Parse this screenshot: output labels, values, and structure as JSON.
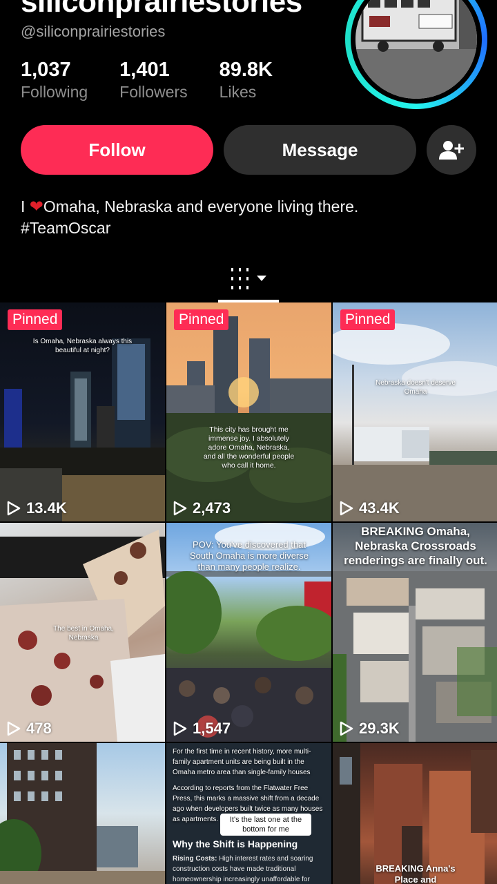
{
  "profile": {
    "display_name": "siliconprairiestories",
    "handle": "@siliconprairiestories",
    "stats": [
      {
        "value": "1,037",
        "label": "Following"
      },
      {
        "value": "1,401",
        "label": "Followers"
      },
      {
        "value": "89.8K",
        "label": "Likes"
      }
    ],
    "bio_line1": "Omaha, Nebraska and everyone living there.",
    "bio_prefix": "I",
    "bio_line2": "#TeamOscar"
  },
  "actions": {
    "follow_label": "Follow",
    "message_label": "Message",
    "add_friend_icon": "add-person-icon"
  },
  "tabs": {
    "active_icon": "grid-filter-icon"
  },
  "videos": [
    {
      "pinned": "Pinned",
      "views": "13.4K",
      "caption": "Is Omaha, Nebraska always this beautiful at night?"
    },
    {
      "pinned": "Pinned",
      "views": "2,473",
      "caption": "This city has brought me immense joy. I absolutely adore Omaha, Nebraska, and all the wonderful people who call it home."
    },
    {
      "pinned": "Pinned",
      "views": "43.4K",
      "caption": "Nebraska doesn't deserve Omaha"
    },
    {
      "views": "478",
      "caption": "The best in Omaha, Nebraska"
    },
    {
      "views": "1,547",
      "caption": "POV: You've discovered that South Omaha is more diverse than many people realize."
    },
    {
      "views": "29.3K",
      "caption": "BREAKING Omaha, Nebraska Crossroads renderings are finally out."
    },
    {
      "views": "",
      "caption": ""
    },
    {
      "views": "",
      "caption_top": "For the first time in recent history, more multi-family apartment units are being built in the Omaha metro area than single-family houses",
      "caption_mid": "According to reports from the Flatwater Free Press, this marks a massive shift from a decade ago when developers built twice as many houses as apartments.",
      "bubble": "It's the last one at the bottom for me",
      "heading": "Why the Shift is Happening",
      "bullet_title": "Rising Costs:",
      "bullet_text": "High interest rates and soaring construction costs have made traditional homeownership increasingly unaffordable for"
    },
    {
      "views": "",
      "caption": "BREAKING Anna's Place and"
    }
  ],
  "colors": {
    "accent": "#fe2c55",
    "button_dark": "#2f2f2f",
    "ring": "#25f4ee"
  }
}
